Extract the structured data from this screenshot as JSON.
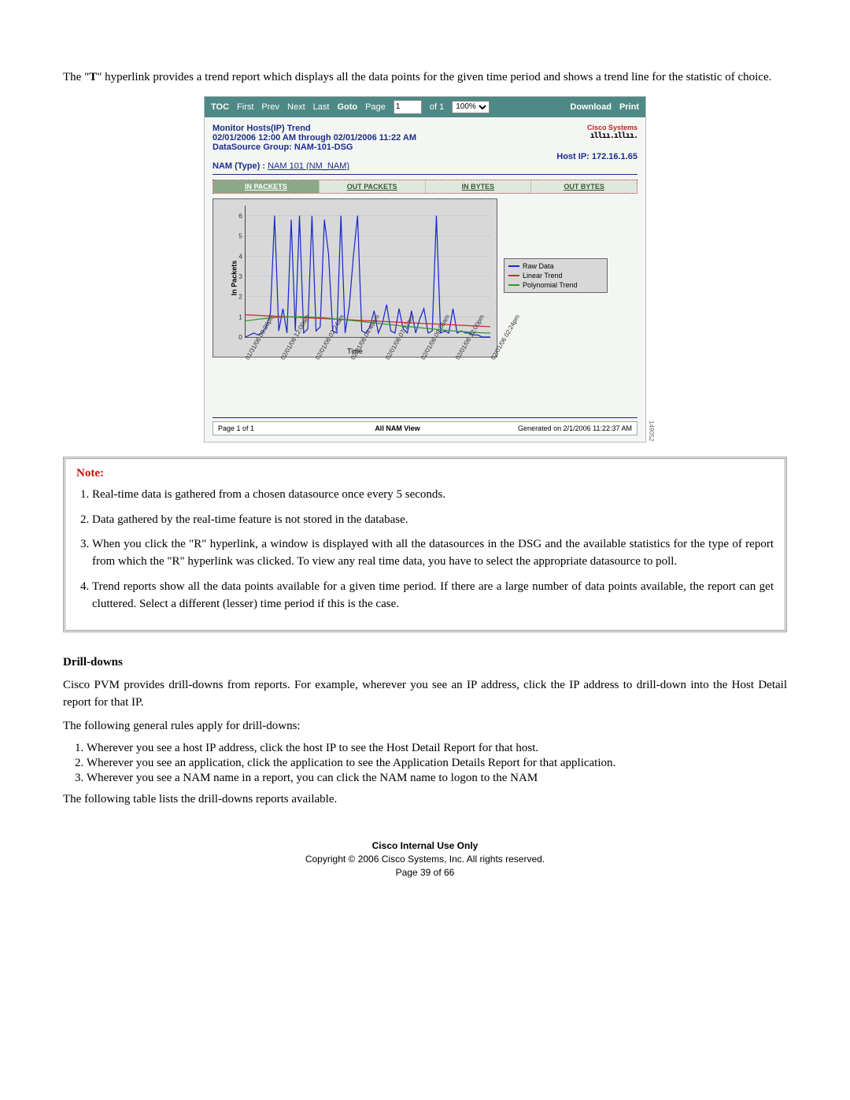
{
  "intro_para_pre": "The \"",
  "intro_para_T": "T",
  "intro_para_post": "\" hyperlink provides a trend report which displays all the data points for the given time period and shows a trend line for the statistic of choice.",
  "screenshot": {
    "side_number": "149052",
    "toolbar": {
      "toc": "TOC",
      "first": "First",
      "prev": "Prev",
      "next": "Next",
      "last": "Last",
      "goto": "Goto",
      "page_label": "Page",
      "page_value": "1",
      "of_pages": "of 1",
      "zoom": "100%",
      "download": "Download",
      "print": "Print"
    },
    "header": {
      "title": "Monitor Hosts(IP) Trend",
      "daterange": "02/01/2006 12:00 AM through 02/01/2006 11:22 AM",
      "dsg_label": "DataSource Group: NAM-101-DSG",
      "hostip_label": "Host IP:  172.16.1.65",
      "nam_label": "NAM (Type) : ",
      "nam_link": "NAM 101 (NM_NAM)",
      "logo_text": "Cisco Systems"
    },
    "tabs": [
      "IN PACKETS",
      "OUT PACKETS",
      "IN BYTES",
      "OUT BYTES"
    ],
    "ylabel": "In Packets",
    "xlabel": "Time",
    "legend": [
      "Raw Data",
      "Linear Trend",
      "Polynomial Trend"
    ],
    "legend_colors": [
      "#1b2acb",
      "#d92525",
      "#2d9a2d"
    ],
    "footer": {
      "left": "Page 1 of 1",
      "center": "All NAM View",
      "right": "Generated on   2/1/2006 11:22:37 AM"
    }
  },
  "chart_data": {
    "type": "line",
    "title": "Monitor Hosts(IP) Trend — In Packets",
    "xlabel": "Time",
    "ylabel": "In Packets",
    "ylim": [
      0,
      6.5
    ],
    "x_ticks": [
      "01/31/06 09:36pm",
      "02/01/06 12:00am",
      "02/01/06 02:24am",
      "02/01/06 04:48am",
      "02/01/06 07:12am",
      "02/01/06 09:36am",
      "02/01/06 12:00pm",
      "02/01/06 02:24pm"
    ],
    "legend": [
      "Raw Data",
      "Linear Trend",
      "Polynomial Trend"
    ],
    "x": [
      0,
      1,
      2,
      3,
      4,
      5,
      6,
      7,
      8,
      9,
      10,
      11,
      12,
      13,
      14,
      15,
      16,
      17,
      18,
      19,
      20,
      21,
      22,
      23,
      24,
      25,
      26,
      27,
      28,
      29,
      30,
      31,
      32,
      33,
      34,
      35,
      36,
      37,
      38,
      39,
      40,
      41,
      42,
      43,
      44,
      45,
      46,
      47,
      48,
      49,
      50,
      51,
      52,
      53,
      54,
      55,
      56,
      57,
      58,
      59
    ],
    "series": [
      {
        "name": "Raw Data",
        "color": "#1b2acb",
        "values": [
          0,
          0.1,
          0.2,
          0.1,
          0.2,
          0.5,
          1.2,
          6,
          0.3,
          1.4,
          0.2,
          5.8,
          0.3,
          6,
          0.2,
          0.4,
          6,
          0.3,
          0.5,
          5.8,
          4.1,
          0.3,
          0.2,
          6,
          0.2,
          1.5,
          4,
          6,
          0.3,
          0.2,
          0.5,
          1.3,
          0.2,
          0.7,
          1.6,
          0.3,
          0.2,
          1.4,
          0.4,
          0.2,
          1.3,
          0.2,
          0.9,
          1.4,
          0.2,
          0.3,
          6,
          0.2,
          0.3,
          0.2,
          1.4,
          0.2,
          0.3,
          0.2,
          0.2,
          0.1,
          0.1,
          0,
          0,
          0
        ]
      },
      {
        "name": "Linear Trend",
        "color": "#d92525",
        "values": [
          1.1,
          1.09,
          1.08,
          1.07,
          1.06,
          1.05,
          1.04,
          1.03,
          1.02,
          1.01,
          1.0,
          0.99,
          0.98,
          0.97,
          0.96,
          0.95,
          0.94,
          0.93,
          0.92,
          0.91,
          0.9,
          0.89,
          0.88,
          0.87,
          0.86,
          0.85,
          0.84,
          0.83,
          0.82,
          0.81,
          0.8,
          0.79,
          0.78,
          0.77,
          0.76,
          0.75,
          0.74,
          0.73,
          0.72,
          0.71,
          0.7,
          0.69,
          0.68,
          0.67,
          0.66,
          0.65,
          0.64,
          0.63,
          0.62,
          0.61,
          0.6,
          0.59,
          0.58,
          0.57,
          0.56,
          0.55,
          0.54,
          0.53,
          0.52,
          0.51
        ]
      },
      {
        "name": "Polynomial Trend",
        "color": "#2d9a2d",
        "values": [
          0.8,
          0.82,
          0.85,
          0.88,
          0.9,
          0.92,
          0.94,
          0.96,
          0.97,
          0.98,
          0.99,
          1.0,
          1.0,
          1.0,
          1.0,
          0.99,
          0.98,
          0.97,
          0.96,
          0.95,
          0.93,
          0.91,
          0.89,
          0.87,
          0.85,
          0.83,
          0.81,
          0.79,
          0.77,
          0.74,
          0.72,
          0.7,
          0.68,
          0.65,
          0.63,
          0.61,
          0.59,
          0.56,
          0.54,
          0.52,
          0.5,
          0.48,
          0.46,
          0.44,
          0.42,
          0.4,
          0.38,
          0.36,
          0.34,
          0.32,
          0.3,
          0.29,
          0.27,
          0.26,
          0.24,
          0.23,
          0.22,
          0.21,
          0.2,
          0.2
        ]
      }
    ]
  },
  "note": {
    "title": "Note:",
    "items": [
      "Real-time data is gathered from a chosen datasource once every 5 seconds.",
      "Data gathered by the real-time feature is not stored in the database.",
      "When you click the \"R\" hyperlink, a window is displayed with all the datasources in the DSG and the available statistics for the type of report from which the \"R\" hyperlink was clicked. To view any real time data, you have to select the appropriate datasource to poll.",
      "Trend reports show all the data points available for a given time period. If there are a large number of data points available, the report can get cluttered. Select a different (lesser) time period if this is the case."
    ]
  },
  "drill": {
    "heading": "Drill-downs",
    "para1": "Cisco PVM provides drill-downs from reports. For example, wherever you see an IP address, click the IP address to drill-down into the Host Detail report for that IP.",
    "para2": "The following general rules apply for drill-downs:",
    "rules": [
      "Wherever you see a host IP address, click the host IP to see the Host Detail Report for that host.",
      "Wherever you see an application, click the application to see the Application Details Report for that application.",
      "Wherever you see a NAM name in a report, you can click the NAM name to logon to the NAM"
    ],
    "para3": "The following table lists the drill-downs reports available."
  },
  "footer": {
    "l1": "Cisco Internal Use Only",
    "l2": "Copyright © 2006 Cisco Systems, Inc. All rights reserved.",
    "l3": "Page 39 of 66"
  }
}
